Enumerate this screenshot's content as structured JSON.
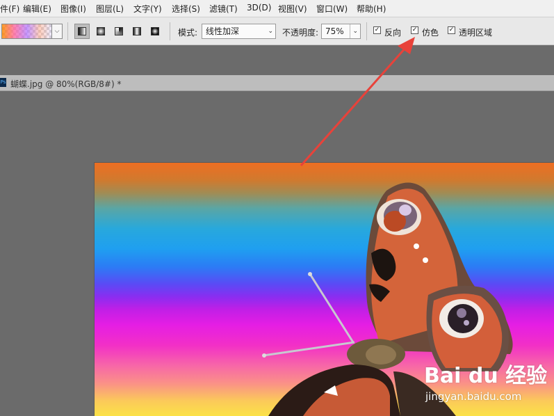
{
  "menubar": {
    "items": [
      "件(F)",
      "编辑(E)",
      "图像(I)",
      "图层(L)",
      "文字(Y)",
      "选择(S)",
      "滤镜(T)",
      "3D(D)",
      "视图(V)",
      "窗口(W)",
      "帮助(H)"
    ]
  },
  "options": {
    "mode_label": "模式:",
    "mode_value": "线性加深",
    "opacity_label": "不透明度:",
    "opacity_value": "75%",
    "reverse_label": "反向",
    "dither_label": "仿色",
    "transparency_label": "透明区域",
    "reverse_checked": true,
    "dither_checked": true,
    "transparency_checked": true,
    "active_gradient_type": "linear"
  },
  "document": {
    "tab_title": "蝴蝶.jpg @ 80%(RGB/8#) *",
    "ps_icon": "Ps"
  },
  "watermark": {
    "logo_text": "Bai du 经验",
    "url": "jingyan.baidu.com"
  },
  "colors": {
    "arrow": "#e8423a",
    "workspace": "#6b6b6b",
    "menubar": "#f0f0f0",
    "optionsbar": "#e8e8e8"
  }
}
